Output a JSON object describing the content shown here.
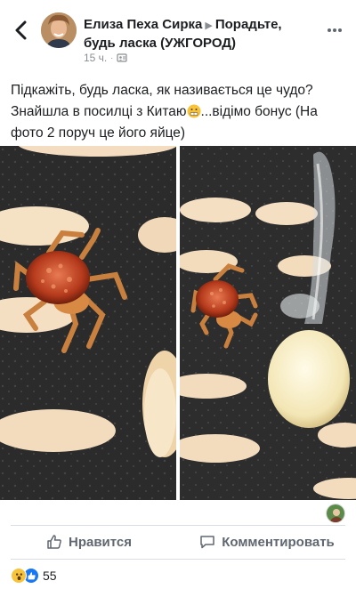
{
  "header": {
    "author": "Елиза Пеха Сирка",
    "group": "Порадьте, будь ласка (УЖГОРОД)",
    "time": "15 ч.",
    "separator": "·"
  },
  "post": {
    "line1": "Підкажіть, будь ласка, як називається це чудо?",
    "line2_a": "Знайшла в посилці з Китаю",
    "line2_b": "...відімо бонус (На",
    "line3": "фото 2 поруч це його яйце)"
  },
  "actions": {
    "like_label": "Нравится",
    "comment_label": "Комментировать"
  },
  "reactions": {
    "count": "55"
  },
  "icons": {
    "back": "chevron-left-icon",
    "more": "more-dots-icon",
    "privacy": "group-privacy-icon",
    "like": "thumbs-up-icon",
    "comment": "comment-bubble-icon",
    "emoji": "grimace-emoji-icon"
  },
  "colors": {
    "text": "#1c1e21",
    "muted": "#8a8d91",
    "action": "#606770",
    "like_blue": "#1877f2",
    "wow_yellow": "#f7c33b"
  }
}
